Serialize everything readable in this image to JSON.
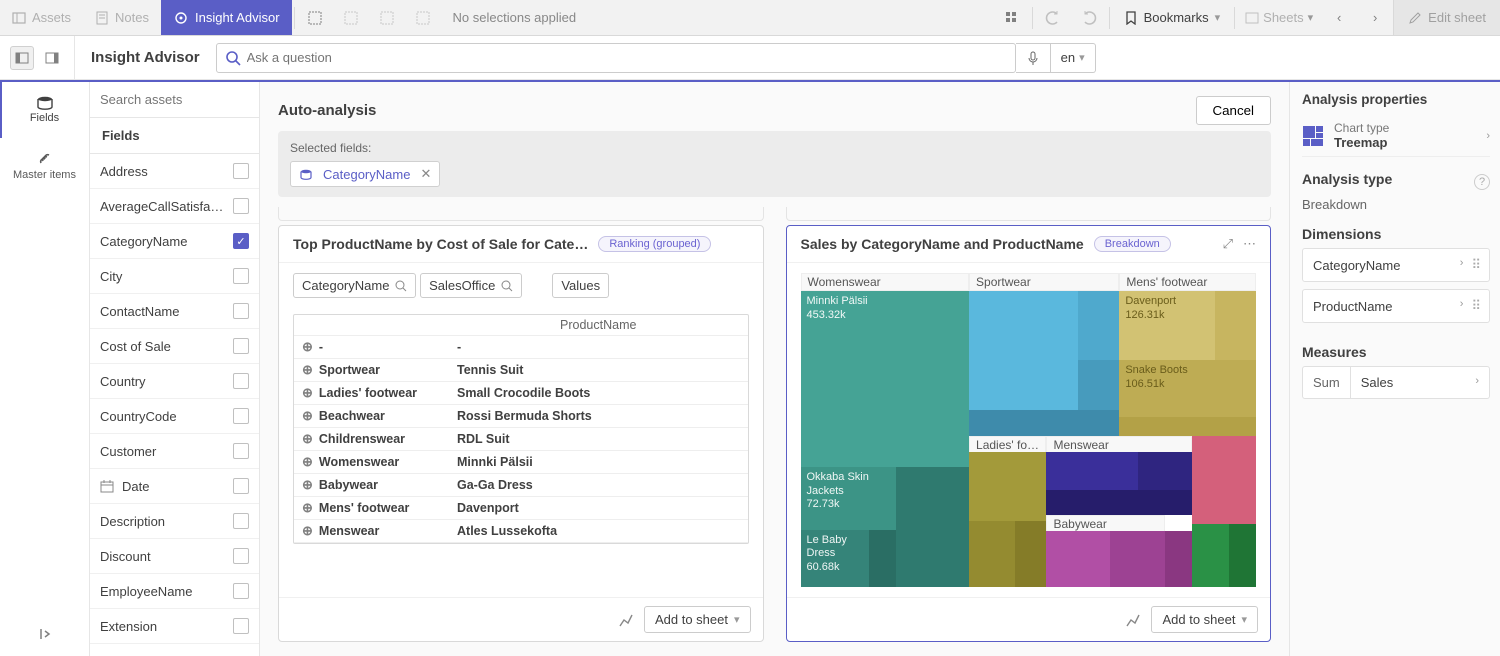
{
  "topbar": {
    "assets": "Assets",
    "notes": "Notes",
    "insight_advisor": "Insight Advisor",
    "no_selections": "No selections applied",
    "bookmarks": "Bookmarks",
    "sheets": "Sheets",
    "edit_sheet": "Edit sheet"
  },
  "title_row": {
    "title": "Insight Advisor",
    "search_placeholder": "Ask a question",
    "lang": "en"
  },
  "vtabs": {
    "fields": "Fields",
    "master_items": "Master items"
  },
  "fields_panel": {
    "search_placeholder": "Search assets",
    "header": "Fields",
    "items": [
      {
        "label": "Address",
        "checked": false,
        "icon": ""
      },
      {
        "label": "AverageCallSatisfac…",
        "checked": false,
        "icon": ""
      },
      {
        "label": "CategoryName",
        "checked": true,
        "icon": ""
      },
      {
        "label": "City",
        "checked": false,
        "icon": ""
      },
      {
        "label": "ContactName",
        "checked": false,
        "icon": ""
      },
      {
        "label": "Cost of Sale",
        "checked": false,
        "icon": ""
      },
      {
        "label": "Country",
        "checked": false,
        "icon": ""
      },
      {
        "label": "CountryCode",
        "checked": false,
        "icon": ""
      },
      {
        "label": "Customer",
        "checked": false,
        "icon": ""
      },
      {
        "label": "Date",
        "checked": false,
        "icon": "cal"
      },
      {
        "label": "Description",
        "checked": false,
        "icon": ""
      },
      {
        "label": "Discount",
        "checked": false,
        "icon": ""
      },
      {
        "label": "EmployeeName",
        "checked": false,
        "icon": ""
      },
      {
        "label": "Extension",
        "checked": false,
        "icon": ""
      }
    ]
  },
  "center": {
    "heading": "Auto-analysis",
    "cancel": "Cancel",
    "selected_label": "Selected fields:",
    "selected_chip": "CategoryName"
  },
  "card1": {
    "title": "Top ProductName by Cost of Sale for Cate…",
    "badge": "Ranking (grouped)",
    "chips": {
      "cat": "CategoryName",
      "off": "SalesOffice",
      "vals": "Values"
    },
    "product_header": "ProductName",
    "rows": [
      {
        "c": "-",
        "p": "-"
      },
      {
        "c": "Sportwear",
        "p": "Tennis Suit"
      },
      {
        "c": "Ladies' footwear",
        "p": "Small Crocodile Boots"
      },
      {
        "c": "Beachwear",
        "p": "Rossi Bermuda Shorts"
      },
      {
        "c": "Childrenswear",
        "p": "RDL Suit"
      },
      {
        "c": "Womenswear",
        "p": "Minnki Pälsii"
      },
      {
        "c": "Babywear",
        "p": "Ga-Ga Dress"
      },
      {
        "c": "Mens' footwear",
        "p": "Davenport"
      },
      {
        "c": "Menswear",
        "p": "Atles Lussekofta"
      }
    ],
    "add": "Add to sheet"
  },
  "card2": {
    "title": "Sales by CategoryName and ProductName",
    "badge": "Breakdown",
    "add": "Add to sheet",
    "cats": {
      "womenswear": "Womenswear",
      "sportwear": "Sportwear",
      "mensfoot": "Mens' footwear",
      "ladiesfoot": "Ladies' fo…",
      "menswear": "Menswear",
      "babywear": "Babywear"
    },
    "blocks": {
      "minnki": {
        "name": "Minnki Pälsii",
        "val": "453.32k"
      },
      "okkaba": {
        "name": "Okkaba Skin Jackets",
        "val": "72.73k"
      },
      "lebaby": {
        "name": "Le Baby Dress",
        "val": "60.68k"
      },
      "davenport": {
        "name": "Davenport",
        "val": "126.31k"
      },
      "snake": {
        "name": "Snake Boots",
        "val": "106.51k"
      }
    }
  },
  "right": {
    "header": "Analysis properties",
    "chart_type_label": "Chart type",
    "chart_type": "Treemap",
    "analysis_type_label": "Analysis type",
    "analysis_type": "Breakdown",
    "dimensions_label": "Dimensions",
    "dim1": "CategoryName",
    "dim2": "ProductName",
    "measures_label": "Measures",
    "agg": "Sum",
    "measure": "Sales"
  },
  "chart_data": {
    "type": "treemap",
    "title": "Sales by CategoryName and ProductName",
    "hierarchy": [
      "CategoryName",
      "ProductName"
    ],
    "measure": "Sales",
    "labeled_leaves": [
      {
        "category": "Womenswear",
        "product": "Minnki Pälsii",
        "value": 453320
      },
      {
        "category": "Womenswear",
        "product": "Okkaba Skin Jackets",
        "value": 72730
      },
      {
        "category": "Womenswear",
        "product": "Le Baby Dress",
        "value": 60680
      },
      {
        "category": "Mens' footwear",
        "product": "Davenport",
        "value": 126310
      },
      {
        "category": "Mens' footwear",
        "product": "Snake Boots",
        "value": 106510
      }
    ],
    "category_proportions_est": {
      "Womenswear": 0.37,
      "Sportwear": 0.2,
      "Mens' footwear": 0.15,
      "Ladies' footwear": 0.09,
      "Menswear": 0.1,
      "Babywear": 0.06,
      "Swimwear": 0.03
    }
  }
}
